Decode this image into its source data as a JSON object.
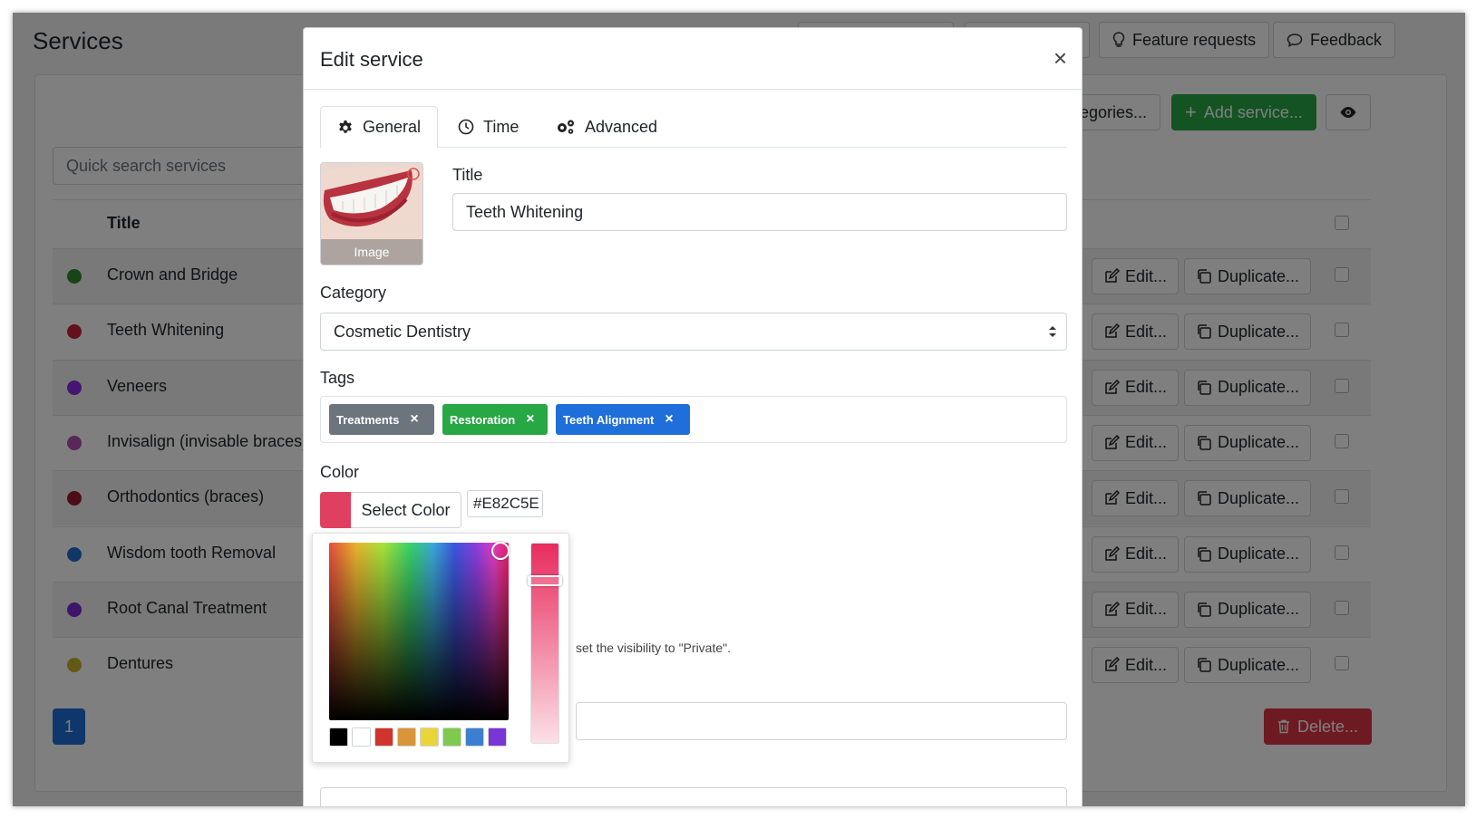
{
  "page": {
    "title": "Services",
    "header_buttons": [
      {
        "label": ""
      },
      {
        "label": ""
      },
      {
        "label": "Feature requests"
      },
      {
        "label": "Feedback"
      }
    ],
    "categories_button": "egories...",
    "add_service_button": "Add service...",
    "search_placeholder": "Quick search services",
    "table_header_title": "Title",
    "rows": [
      {
        "name": "Crown and Bridge",
        "color": "#2e8b2e",
        "edit": "Edit...",
        "duplicate": "Duplicate..."
      },
      {
        "name": "Teeth Whitening",
        "color": "#c7243a",
        "edit": "Edit...",
        "duplicate": "Duplicate..."
      },
      {
        "name": "Veneers",
        "color": "#8a2be2",
        "edit": "Edit...",
        "duplicate": "Duplicate..."
      },
      {
        "name": "Invisalign (invisable braces)",
        "color": "#b34fb0",
        "edit": "Edit...",
        "duplicate": "Duplicate..."
      },
      {
        "name": "Orthodontics (braces)",
        "color": "#9b1b30",
        "edit": "Edit...",
        "duplicate": "Duplicate..."
      },
      {
        "name": "Wisdom tooth Removal",
        "color": "#1f6fd0",
        "edit": "Edit...",
        "duplicate": "Duplicate..."
      },
      {
        "name": "Root Canal Treatment",
        "color": "#7a2bd4",
        "edit": "Edit...",
        "duplicate": "Duplicate..."
      },
      {
        "name": "Dentures",
        "color": "#c9b02a",
        "edit": "Edit...",
        "duplicate": "Duplicate..."
      }
    ],
    "pagination_current": "1",
    "delete_button": "Delete..."
  },
  "modal": {
    "title": "Edit service",
    "close": "×",
    "tabs": [
      {
        "label": "General",
        "icon": "gear-icon",
        "active": true
      },
      {
        "label": "Time",
        "icon": "clock-icon",
        "active": false
      },
      {
        "label": "Advanced",
        "icon": "gears-icon",
        "active": false
      }
    ],
    "image_label": "Image",
    "title_label": "Title",
    "title_value": "Teeth Whitening",
    "category_label": "Category",
    "category_value": "Cosmetic Dentistry",
    "tags_label": "Tags",
    "tags": [
      {
        "label": "Treatments",
        "color": "#6c757d"
      },
      {
        "label": "Restoration",
        "color": "#28a745"
      },
      {
        "label": "Teeth Alignment",
        "color": "#1e6fd9"
      }
    ],
    "color_label": "Color",
    "color_select_label": "Select Color",
    "color_hex": "#E82C5E",
    "color_value": "#e0405f",
    "preset_colors": [
      "#000000",
      "#ffffff",
      "#d0342c",
      "#d9953a",
      "#e9d53a",
      "#7fc94f",
      "#3c7fd0",
      "#7a35d6"
    ],
    "help_text": "set the visibility to \"Private\"."
  }
}
